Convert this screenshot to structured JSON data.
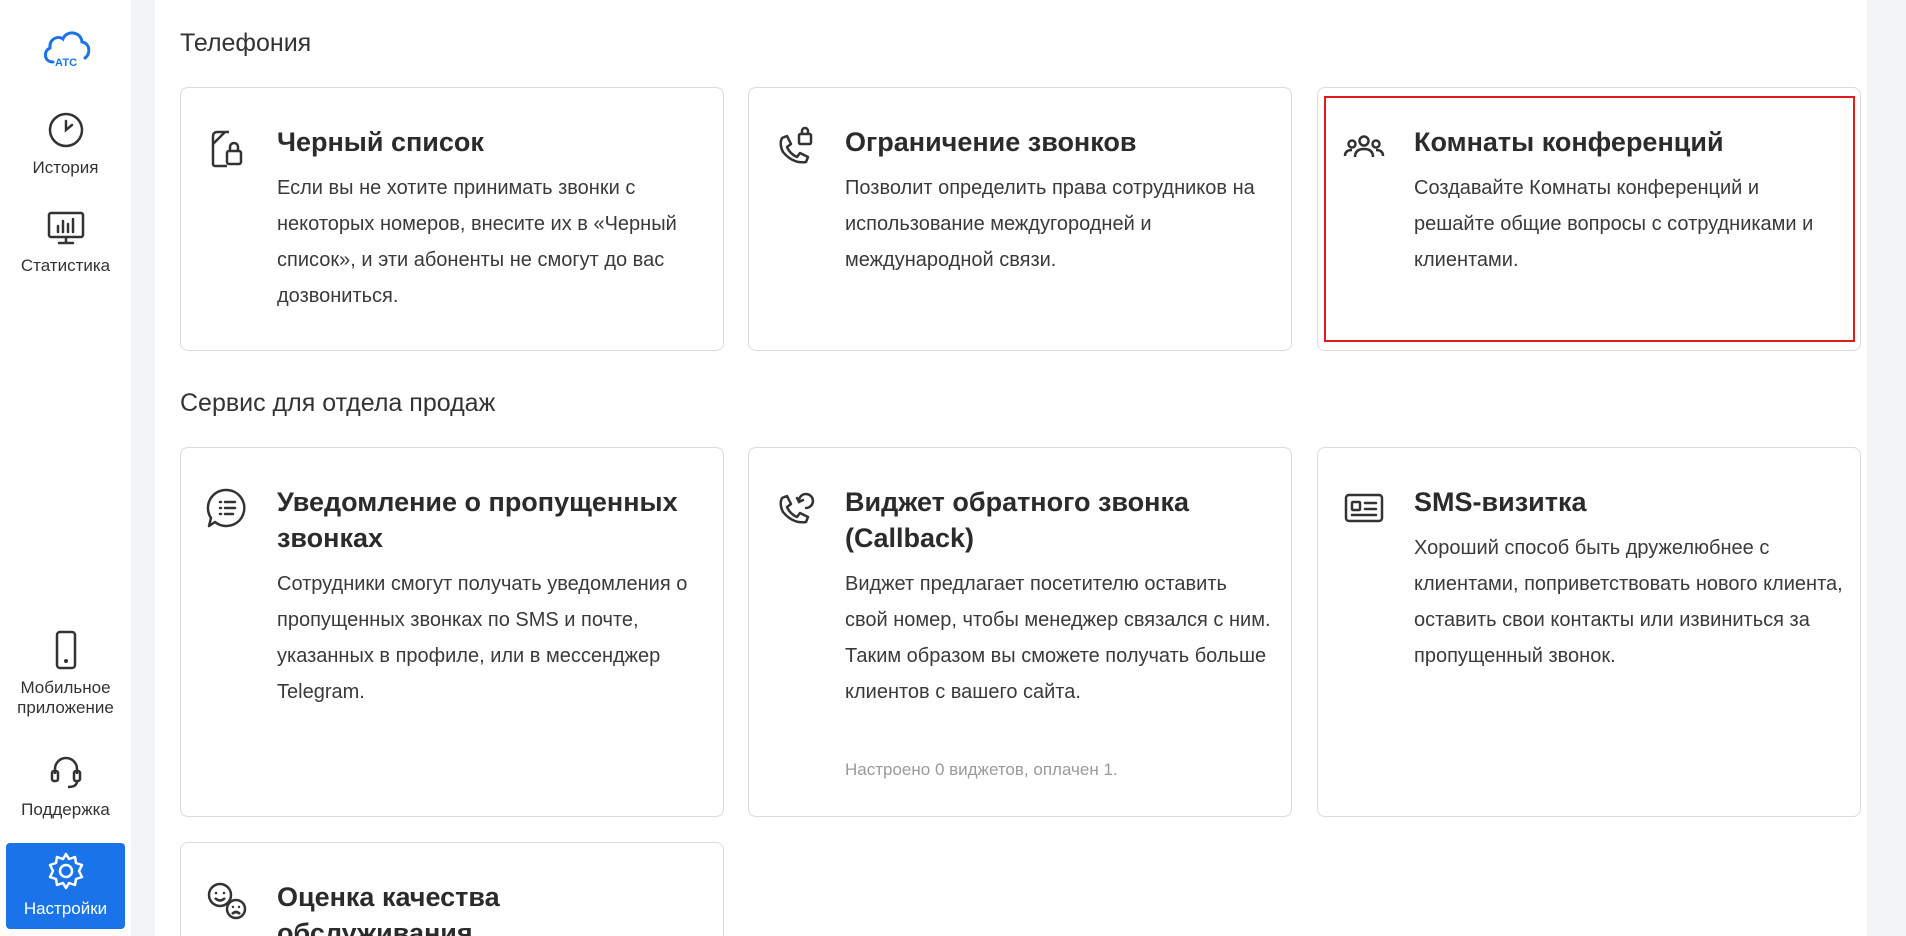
{
  "sidebar": {
    "logo_text": "АТС",
    "items": [
      {
        "label": "История",
        "icon": "clock-icon"
      },
      {
        "label": "Статистика",
        "icon": "chart-monitor-icon"
      },
      {
        "label": "Мобильное приложение",
        "icon": "phone-icon"
      },
      {
        "label": "Поддержка",
        "icon": "headset-icon"
      },
      {
        "label": "Настройки",
        "icon": "gear-icon",
        "active": true
      }
    ],
    "active_color": "#1a73e8"
  },
  "sections": [
    {
      "title": "Телефония",
      "cards": [
        {
          "title": "Черный список",
          "icon": "lock-document-icon",
          "description": "Если вы не хотите принимать звонки с некоторых номеров, внесите их в «Черный список», и эти абоненты не смогут до вас дозвониться."
        },
        {
          "title": "Ограничение звонков",
          "icon": "phone-lock-icon",
          "description": "Позволит определить права сотрудников на использование междугородней и международной связи."
        },
        {
          "title": "Комнаты конференций",
          "icon": "users-icon",
          "description": "Создавайте Комнаты конференций и решайте общие вопросы с сотрудниками и клиентами."
        }
      ]
    },
    {
      "title": "Сервис для отдела продаж",
      "cards": [
        {
          "title": "Уведомление о пропущенных звонках",
          "icon": "chat-list-icon",
          "description": "Сотрудники смогут получать уведомления о пропущенных звонках по SMS и почте, указанных в профиле, или в мессенджер Telegram."
        },
        {
          "title": "Виджет обратного звонка (Callback)",
          "icon": "phone-callback-icon",
          "description": "Виджет предлагает посетителю оставить свой номер, чтобы менеджер связался с ним. Таким образом вы сможете получать больше клиентов с вашего сайта.",
          "note": "Настроено 0 виджетов, оплачен 1."
        },
        {
          "title": "SMS-визитка",
          "icon": "id-card-icon",
          "description": "Хороший способ быть дружелюбнее с клиентами, поприветствовать нового клиента, оставить свои контакты или извиниться за пропущенный звонок."
        },
        {
          "title": "Оценка качества обслуживания",
          "icon": "smiley-faces-icon",
          "description": ""
        }
      ]
    }
  ],
  "highlight_color": "#e21b1b"
}
